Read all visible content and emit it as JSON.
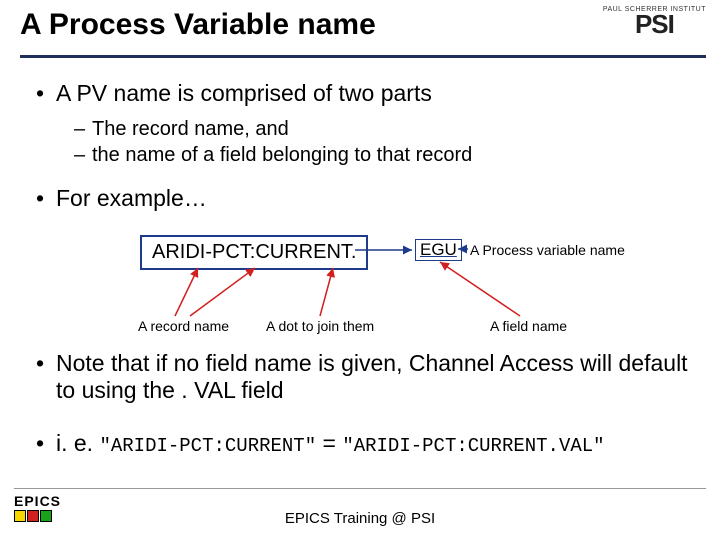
{
  "title": "A Process Variable name",
  "logo": {
    "topText": "PAUL SCHERRER INSTITUT",
    "main": "PSI"
  },
  "bullets": {
    "b1": "A PV name is comprised of two parts",
    "b1a": "The record name, and",
    "b1b": "the name of a field belonging to that record",
    "b2": "For example…",
    "b3": "Note that if no field name is given, Channel Access will default to using the . VAL field",
    "b4_prefix": "i. e. ",
    "b4_q1": "\"ARIDI-PCT:CURRENT\"",
    "b4_eq": " = ",
    "b4_q2": "\"ARIDI-PCT:CURRENT.VAL\""
  },
  "example": {
    "record": "ARIDI-PCT:CURRENT",
    "dot": ".",
    "field": "EGU",
    "pvLabel": "A Process variable name",
    "recordLabel": "A record name",
    "dotLabel": "A dot to join them",
    "fieldLabel": "A field name"
  },
  "footer": {
    "epics": "EPICS",
    "text": "EPICS Training @ PSI"
  },
  "colors": {
    "sqYellow": "#f5d600",
    "sqRed": "#d21f1f",
    "sqGreen": "#1aa31a"
  }
}
